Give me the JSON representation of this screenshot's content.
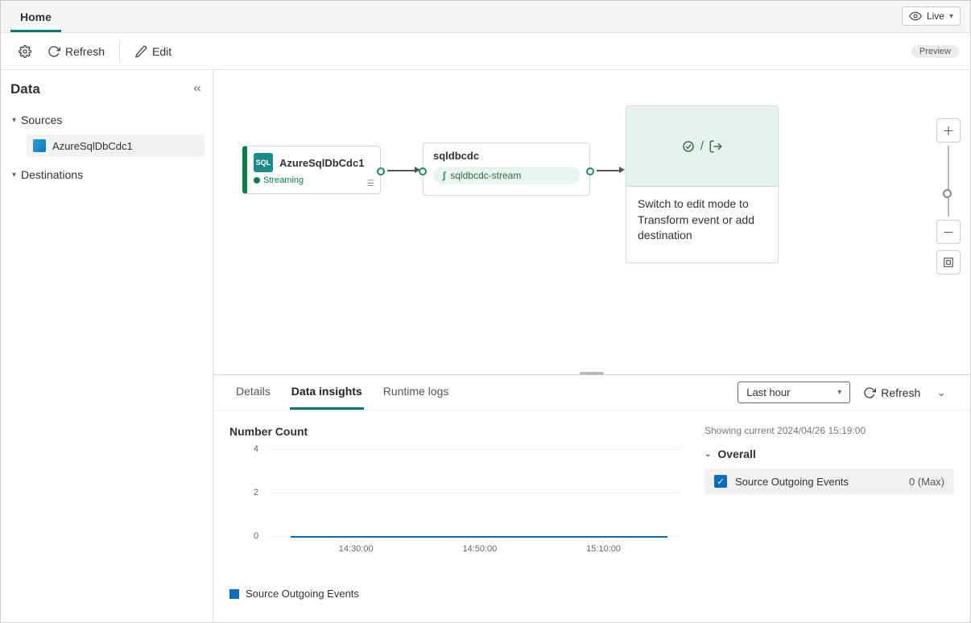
{
  "topbar": {
    "tabs": [
      "Home"
    ],
    "live_label": "Live"
  },
  "toolbar": {
    "refresh_label": "Refresh",
    "edit_label": "Edit",
    "preview_pill": "Preview"
  },
  "sidebar": {
    "title": "Data",
    "sources_label": "Sources",
    "destinations_label": "Destinations",
    "source_items": [
      "AzureSqlDbCdc1"
    ]
  },
  "canvas": {
    "source_node": {
      "title": "AzureSqlDbCdc1",
      "status": "Streaming"
    },
    "middle_node": {
      "title": "sqldbcdc",
      "stream": "sqldbcdc-stream"
    },
    "action_node": {
      "text": "Switch to edit mode to Transform event or add destination"
    }
  },
  "panel": {
    "tabs": {
      "details": "Details",
      "insights": "Data insights",
      "logs": "Runtime logs"
    },
    "time_range": "Last hour",
    "refresh_label": "Refresh",
    "showing_label": "Showing current 2024/04/26 15:19:00",
    "overall_label": "Overall",
    "metric_name": "Source Outgoing Events",
    "metric_value": "0 (Max)",
    "legend_label": "Source Outgoing Events"
  },
  "chart_data": {
    "type": "line",
    "title": "Number Count",
    "xlabel": "",
    "ylabel": "",
    "ylim": [
      0,
      4
    ],
    "yticks": [
      0,
      2,
      4
    ],
    "xticks": [
      "14:30:00",
      "14:50:00",
      "15:10:00"
    ],
    "series": [
      {
        "name": "Source Outgoing Events",
        "color": "#0e6cbd",
        "x": [
          "14:30:00",
          "14:50:00",
          "15:10:00"
        ],
        "values": [
          0,
          0,
          0
        ]
      }
    ]
  }
}
